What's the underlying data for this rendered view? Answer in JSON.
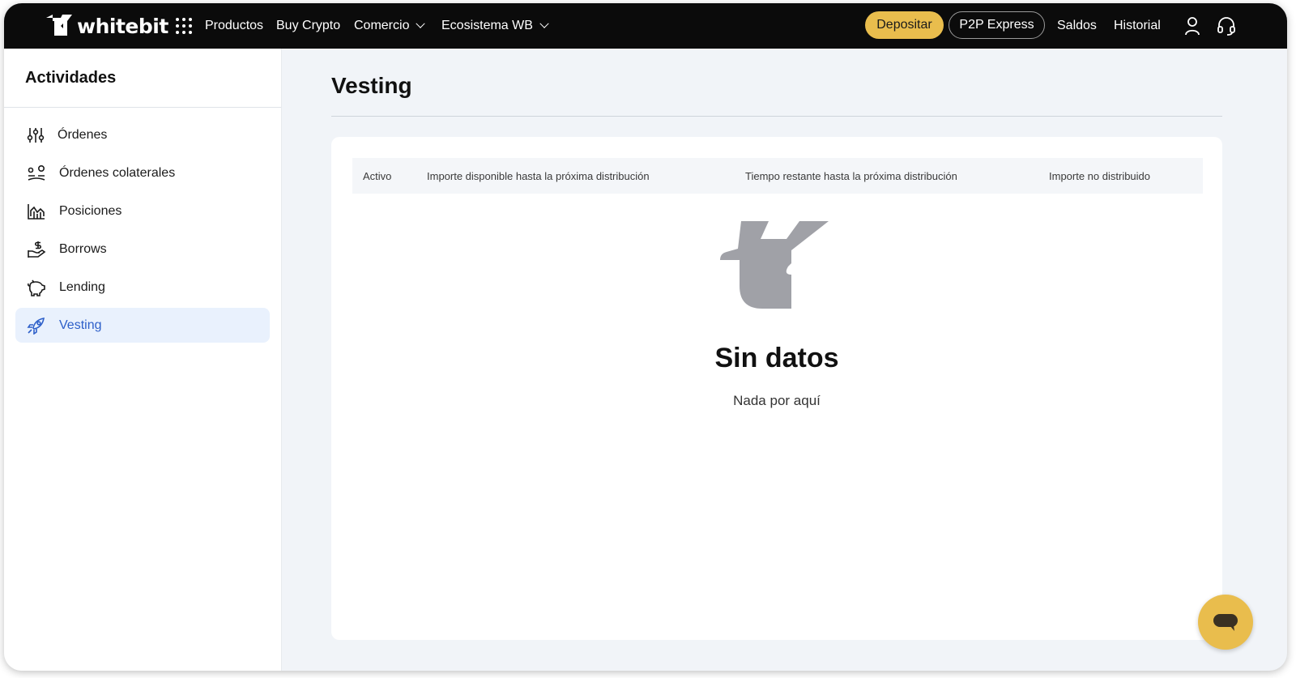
{
  "brand": {
    "name": "whitebit"
  },
  "topnav": {
    "products": "Productos",
    "buy_crypto": "Buy Crypto",
    "commerce": "Comercio",
    "ecosystem": "Ecosistema WB",
    "deposit": "Depositar",
    "p2p": "P2P Express",
    "balances": "Saldos",
    "history": "Historial"
  },
  "sidebar": {
    "title": "Actividades",
    "items": [
      {
        "label": "Órdenes",
        "icon": "sliders-icon"
      },
      {
        "label": "Órdenes colaterales",
        "icon": "collateral-icon"
      },
      {
        "label": "Posiciones",
        "icon": "chart-icon"
      },
      {
        "label": "Borrows",
        "icon": "hand-dollar-icon"
      },
      {
        "label": "Lending",
        "icon": "piggy-bank-icon"
      },
      {
        "label": "Vesting",
        "icon": "rocket-icon",
        "active": true
      }
    ]
  },
  "main": {
    "title": "Vesting",
    "columns": [
      "Activo",
      "Importe disponible hasta la próxima distribución",
      "Tiempo restante hasta la próxima distribución",
      "Importe no distribuido"
    ],
    "empty_title": "Sin datos",
    "empty_subtitle": "Nada por aquí"
  },
  "colors": {
    "accent": "#e9bd4d",
    "active_bg": "#e9f1fd",
    "active_text": "#2d5fc9",
    "topbar": "#0b0b0b"
  }
}
